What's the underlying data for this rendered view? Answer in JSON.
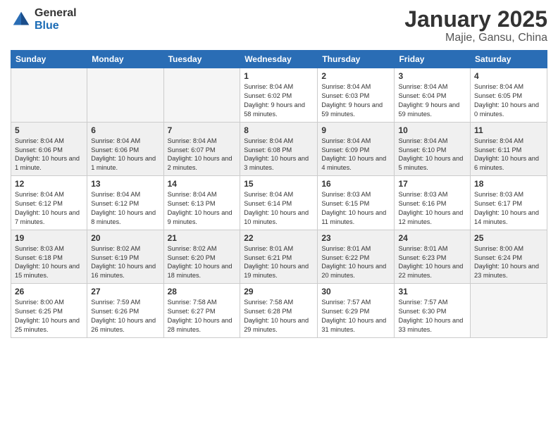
{
  "logo": {
    "general": "General",
    "blue": "Blue"
  },
  "title": "January 2025",
  "subtitle": "Majie, Gansu, China",
  "days_of_week": [
    "Sunday",
    "Monday",
    "Tuesday",
    "Wednesday",
    "Thursday",
    "Friday",
    "Saturday"
  ],
  "weeks": [
    [
      {
        "day": "",
        "sunrise": "",
        "sunset": "",
        "daylight": "",
        "empty": true
      },
      {
        "day": "",
        "sunrise": "",
        "sunset": "",
        "daylight": "",
        "empty": true
      },
      {
        "day": "",
        "sunrise": "",
        "sunset": "",
        "daylight": "",
        "empty": true
      },
      {
        "day": "1",
        "sunrise": "Sunrise: 8:04 AM",
        "sunset": "Sunset: 6:02 PM",
        "daylight": "Daylight: 9 hours and 58 minutes.",
        "empty": false
      },
      {
        "day": "2",
        "sunrise": "Sunrise: 8:04 AM",
        "sunset": "Sunset: 6:03 PM",
        "daylight": "Daylight: 9 hours and 59 minutes.",
        "empty": false
      },
      {
        "day": "3",
        "sunrise": "Sunrise: 8:04 AM",
        "sunset": "Sunset: 6:04 PM",
        "daylight": "Daylight: 9 hours and 59 minutes.",
        "empty": false
      },
      {
        "day": "4",
        "sunrise": "Sunrise: 8:04 AM",
        "sunset": "Sunset: 6:05 PM",
        "daylight": "Daylight: 10 hours and 0 minutes.",
        "empty": false
      }
    ],
    [
      {
        "day": "5",
        "sunrise": "Sunrise: 8:04 AM",
        "sunset": "Sunset: 6:06 PM",
        "daylight": "Daylight: 10 hours and 1 minute.",
        "empty": false
      },
      {
        "day": "6",
        "sunrise": "Sunrise: 8:04 AM",
        "sunset": "Sunset: 6:06 PM",
        "daylight": "Daylight: 10 hours and 1 minute.",
        "empty": false
      },
      {
        "day": "7",
        "sunrise": "Sunrise: 8:04 AM",
        "sunset": "Sunset: 6:07 PM",
        "daylight": "Daylight: 10 hours and 2 minutes.",
        "empty": false
      },
      {
        "day": "8",
        "sunrise": "Sunrise: 8:04 AM",
        "sunset": "Sunset: 6:08 PM",
        "daylight": "Daylight: 10 hours and 3 minutes.",
        "empty": false
      },
      {
        "day": "9",
        "sunrise": "Sunrise: 8:04 AM",
        "sunset": "Sunset: 6:09 PM",
        "daylight": "Daylight: 10 hours and 4 minutes.",
        "empty": false
      },
      {
        "day": "10",
        "sunrise": "Sunrise: 8:04 AM",
        "sunset": "Sunset: 6:10 PM",
        "daylight": "Daylight: 10 hours and 5 minutes.",
        "empty": false
      },
      {
        "day": "11",
        "sunrise": "Sunrise: 8:04 AM",
        "sunset": "Sunset: 6:11 PM",
        "daylight": "Daylight: 10 hours and 6 minutes.",
        "empty": false
      }
    ],
    [
      {
        "day": "12",
        "sunrise": "Sunrise: 8:04 AM",
        "sunset": "Sunset: 6:12 PM",
        "daylight": "Daylight: 10 hours and 7 minutes.",
        "empty": false
      },
      {
        "day": "13",
        "sunrise": "Sunrise: 8:04 AM",
        "sunset": "Sunset: 6:12 PM",
        "daylight": "Daylight: 10 hours and 8 minutes.",
        "empty": false
      },
      {
        "day": "14",
        "sunrise": "Sunrise: 8:04 AM",
        "sunset": "Sunset: 6:13 PM",
        "daylight": "Daylight: 10 hours and 9 minutes.",
        "empty": false
      },
      {
        "day": "15",
        "sunrise": "Sunrise: 8:04 AM",
        "sunset": "Sunset: 6:14 PM",
        "daylight": "Daylight: 10 hours and 10 minutes.",
        "empty": false
      },
      {
        "day": "16",
        "sunrise": "Sunrise: 8:03 AM",
        "sunset": "Sunset: 6:15 PM",
        "daylight": "Daylight: 10 hours and 11 minutes.",
        "empty": false
      },
      {
        "day": "17",
        "sunrise": "Sunrise: 8:03 AM",
        "sunset": "Sunset: 6:16 PM",
        "daylight": "Daylight: 10 hours and 12 minutes.",
        "empty": false
      },
      {
        "day": "18",
        "sunrise": "Sunrise: 8:03 AM",
        "sunset": "Sunset: 6:17 PM",
        "daylight": "Daylight: 10 hours and 14 minutes.",
        "empty": false
      }
    ],
    [
      {
        "day": "19",
        "sunrise": "Sunrise: 8:03 AM",
        "sunset": "Sunset: 6:18 PM",
        "daylight": "Daylight: 10 hours and 15 minutes.",
        "empty": false
      },
      {
        "day": "20",
        "sunrise": "Sunrise: 8:02 AM",
        "sunset": "Sunset: 6:19 PM",
        "daylight": "Daylight: 10 hours and 16 minutes.",
        "empty": false
      },
      {
        "day": "21",
        "sunrise": "Sunrise: 8:02 AM",
        "sunset": "Sunset: 6:20 PM",
        "daylight": "Daylight: 10 hours and 18 minutes.",
        "empty": false
      },
      {
        "day": "22",
        "sunrise": "Sunrise: 8:01 AM",
        "sunset": "Sunset: 6:21 PM",
        "daylight": "Daylight: 10 hours and 19 minutes.",
        "empty": false
      },
      {
        "day": "23",
        "sunrise": "Sunrise: 8:01 AM",
        "sunset": "Sunset: 6:22 PM",
        "daylight": "Daylight: 10 hours and 20 minutes.",
        "empty": false
      },
      {
        "day": "24",
        "sunrise": "Sunrise: 8:01 AM",
        "sunset": "Sunset: 6:23 PM",
        "daylight": "Daylight: 10 hours and 22 minutes.",
        "empty": false
      },
      {
        "day": "25",
        "sunrise": "Sunrise: 8:00 AM",
        "sunset": "Sunset: 6:24 PM",
        "daylight": "Daylight: 10 hours and 23 minutes.",
        "empty": false
      }
    ],
    [
      {
        "day": "26",
        "sunrise": "Sunrise: 8:00 AM",
        "sunset": "Sunset: 6:25 PM",
        "daylight": "Daylight: 10 hours and 25 minutes.",
        "empty": false
      },
      {
        "day": "27",
        "sunrise": "Sunrise: 7:59 AM",
        "sunset": "Sunset: 6:26 PM",
        "daylight": "Daylight: 10 hours and 26 minutes.",
        "empty": false
      },
      {
        "day": "28",
        "sunrise": "Sunrise: 7:58 AM",
        "sunset": "Sunset: 6:27 PM",
        "daylight": "Daylight: 10 hours and 28 minutes.",
        "empty": false
      },
      {
        "day": "29",
        "sunrise": "Sunrise: 7:58 AM",
        "sunset": "Sunset: 6:28 PM",
        "daylight": "Daylight: 10 hours and 29 minutes.",
        "empty": false
      },
      {
        "day": "30",
        "sunrise": "Sunrise: 7:57 AM",
        "sunset": "Sunset: 6:29 PM",
        "daylight": "Daylight: 10 hours and 31 minutes.",
        "empty": false
      },
      {
        "day": "31",
        "sunrise": "Sunrise: 7:57 AM",
        "sunset": "Sunset: 6:30 PM",
        "daylight": "Daylight: 10 hours and 33 minutes.",
        "empty": false
      },
      {
        "day": "",
        "sunrise": "",
        "sunset": "",
        "daylight": "",
        "empty": true
      }
    ]
  ]
}
